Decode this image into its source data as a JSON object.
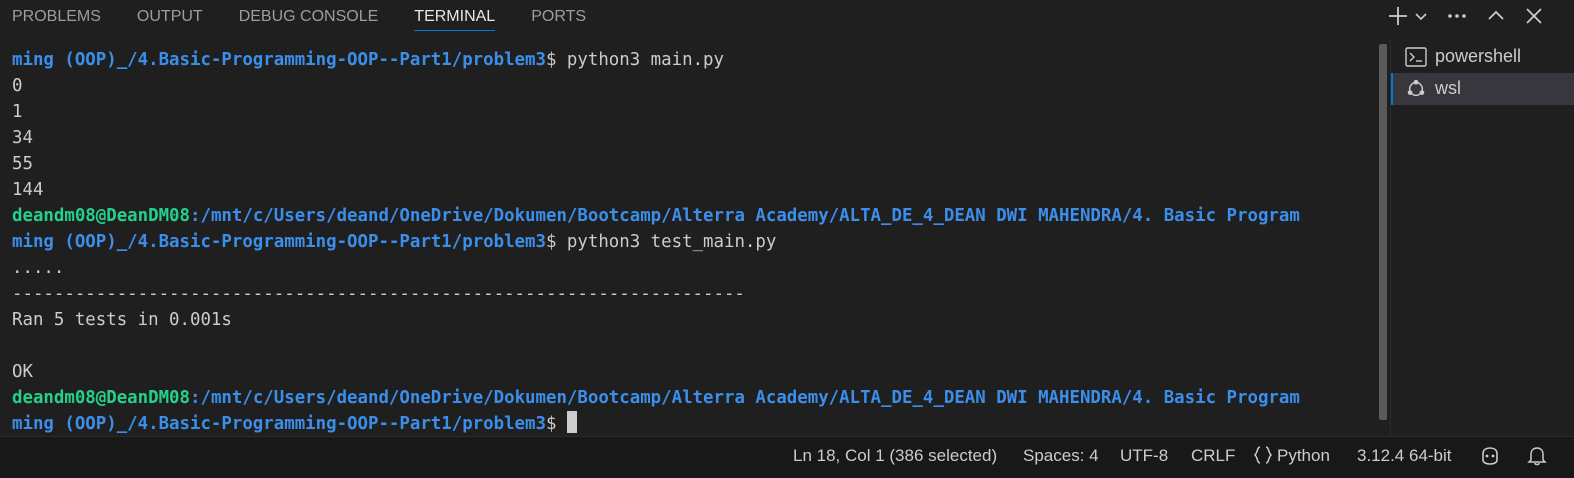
{
  "panel": {
    "tabs": [
      {
        "label": "PROBLEMS"
      },
      {
        "label": "OUTPUT"
      },
      {
        "label": "DEBUG CONSOLE"
      },
      {
        "label": "TERMINAL"
      },
      {
        "label": "PORTS"
      }
    ],
    "active_tab": "TERMINAL",
    "actions": [
      {
        "icon": "plus-icon"
      },
      {
        "icon": "chevron-down-icon"
      },
      {
        "icon": "ellipsis-icon"
      },
      {
        "icon": "chevron-up-icon"
      },
      {
        "icon": "close-icon"
      }
    ]
  },
  "terminal": {
    "lines": {
      "l1": {
        "path": "ming (OOP)_/4.Basic-Programming-OOP--Part1/problem3",
        "cmd": "$ python3 main.py"
      },
      "l2": "0",
      "l3": "1",
      "l4": "34",
      "l5": "55",
      "l6": "144",
      "l7": {
        "user": "deandm08@DeanDM08",
        "path": ":/mnt/c/Users/deand/OneDrive/Dokumen/Bootcamp/Alterra Academy/ALTA_DE_4_DEAN DWI MAHENDRA/4. Basic Program"
      },
      "l8": {
        "path": "ming (OOP)_/4.Basic-Programming-OOP--Part1/problem3",
        "cmd": "$ python3 test_main.py"
      },
      "l9": ".....",
      "l10": "----------------------------------------------------------------------",
      "l11": "Ran 5 tests in 0.001s",
      "l12": "",
      "l13": "OK",
      "l14": {
        "user": "deandm08@DeanDM08",
        "path": ":/mnt/c/Users/deand/OneDrive/Dokumen/Bootcamp/Alterra Academy/ALTA_DE_4_DEAN DWI MAHENDRA/4. Basic Program"
      },
      "l15": {
        "path": "ming (OOP)_/4.Basic-Programming-OOP--Part1/problem3",
        "cmd": "$ "
      }
    },
    "colors": {
      "user": "#23d18b",
      "path": "#3b8eea",
      "text": "#cccccc",
      "background": "#1f1f1f"
    }
  },
  "terminal_list": [
    {
      "label": "powershell",
      "icon": "terminal-icon"
    },
    {
      "label": "wsl",
      "icon": "linux-icon",
      "selected": true
    }
  ],
  "statusbar": {
    "position": "Ln 18, Col 1 (386 selected)",
    "spaces": "Spaces: 4",
    "encoding": "UTF-8",
    "eol": "CRLF",
    "language": "Python",
    "interpreter": "3.12.4 64-bit",
    "icons": [
      "braces-icon",
      "copilot-icon",
      "bell-icon"
    ]
  }
}
